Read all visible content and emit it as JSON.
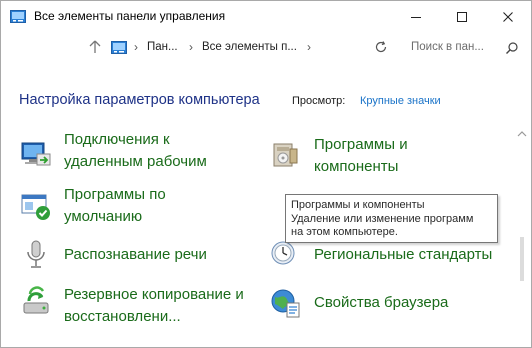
{
  "window": {
    "title": "Все элементы панели управления"
  },
  "address_bar": {
    "crumbs": [
      "Пан...",
      "Все элементы п..."
    ],
    "search_placeholder": "Поиск в пан..."
  },
  "header": {
    "title": "Настройка параметров компьютера",
    "view_label": "Просмотр:",
    "view_value": "Крупные значки"
  },
  "items": [
    {
      "line1": "Подключения к",
      "line2": "удаленным рабочим",
      "icon": "remote-desktop-icon"
    },
    {
      "line1": "Программы и",
      "line2": "компоненты",
      "icon": "programs-features-icon"
    },
    {
      "line1": "Программы по",
      "line2": "умолчанию",
      "icon": "default-programs-icon"
    },
    {
      "line1": "Распознавание речи",
      "line2": "",
      "icon": "speech-recognition-icon"
    },
    {
      "line1": "Региональные стандарты",
      "line2": "",
      "icon": "region-icon"
    },
    {
      "line1": "Резервное копирование и",
      "line2": "восстановлени...",
      "icon": "backup-restore-icon"
    },
    {
      "line1": "Свойства браузера",
      "line2": "",
      "icon": "internet-options-icon"
    }
  ],
  "tooltip": {
    "lines": [
      "Программы и компоненты",
      "Удаление или изменение программ",
      "на этом компьютере."
    ]
  },
  "colors": {
    "title_blue": "#1e3287",
    "link_green": "#1a6b1a",
    "view_value_blue": "#1a73c8"
  }
}
